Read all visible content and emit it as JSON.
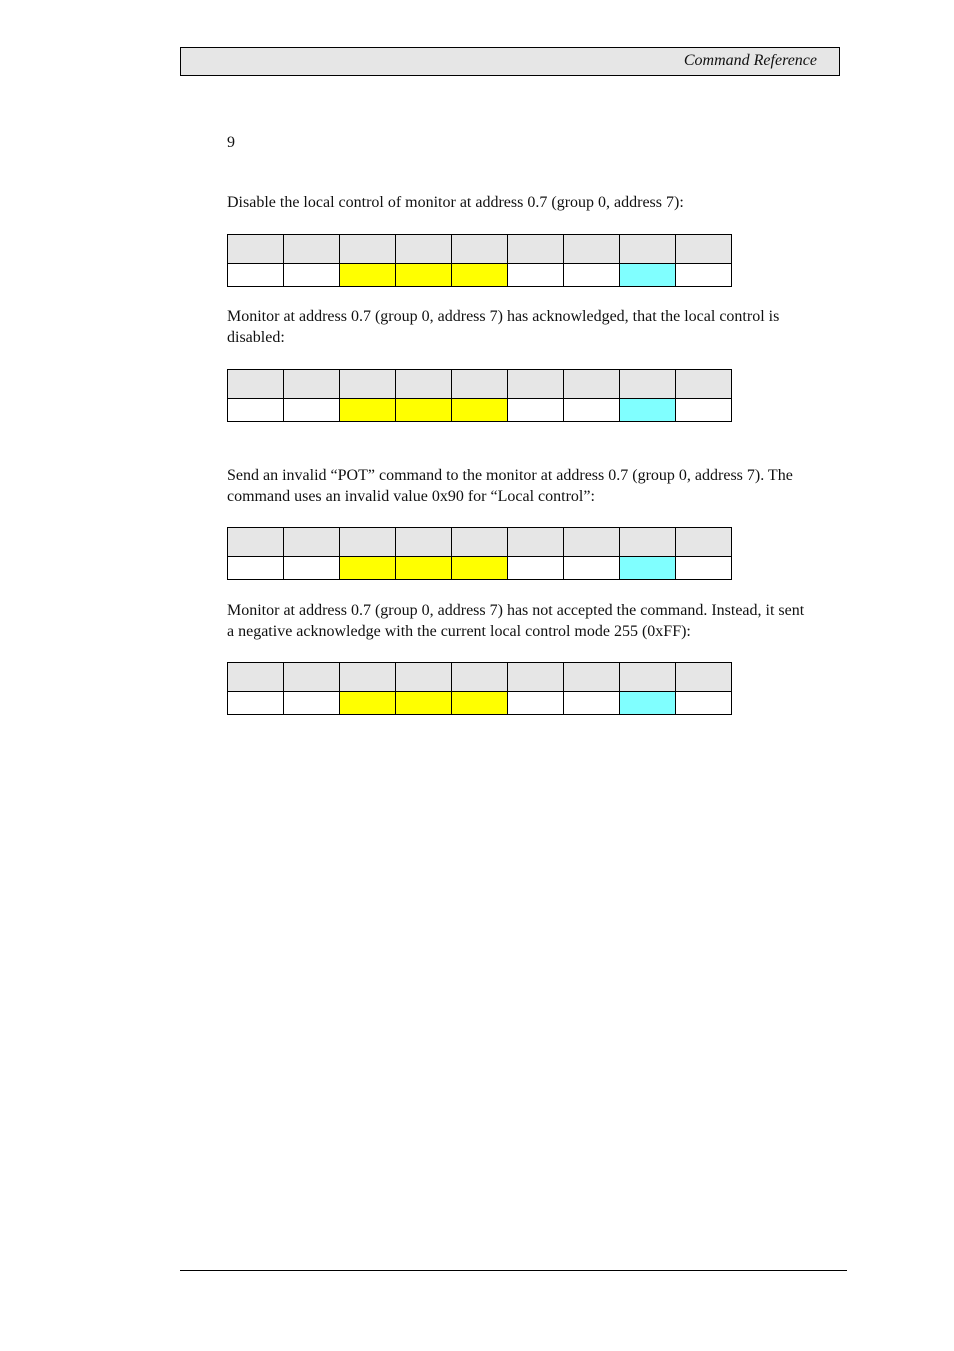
{
  "header": {
    "title": "Command Reference"
  },
  "section_number": "9",
  "blocks": [
    {
      "text": "Disable the local control of monitor at address 0.7 (group 0, address 7):"
    },
    {
      "text": "Monitor at address 0.7 (group 0, address 7) has acknowledged, that the local control is disabled:"
    },
    {
      "text": "Send an invalid “POT” command to the monitor at address 0.7 (group 0, address 7). The command uses an invalid value 0x90 for “Local control”:"
    },
    {
      "text": "Monitor at address 0.7 (group 0, address 7) has not accepted the command. Instead, it sent a negative acknowledge with the current local control mode 255 (0xFF):"
    }
  ],
  "frame_table": {
    "columns": 9,
    "header_cells": [
      "",
      "",
      "",
      "",
      "",
      "",
      "",
      "",
      ""
    ],
    "value_cells": [
      "",
      "",
      "",
      "",
      "",
      "",
      "",
      "",
      ""
    ],
    "highlight_colors": {
      "header": "#e6e6e6",
      "command_bytes": "#ffff00",
      "checksum_byte": "#80ffff"
    }
  }
}
